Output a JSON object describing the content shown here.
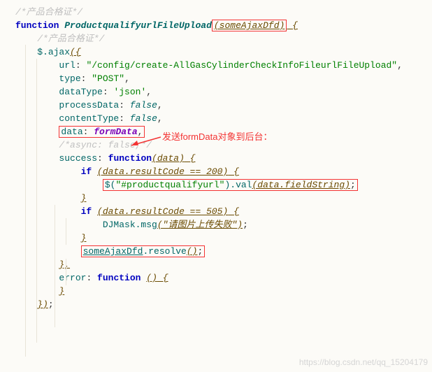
{
  "comments": {
    "top": "/*产品合格证*/",
    "inner": "/*产品合格证*/",
    "async": "/*async: false,*/"
  },
  "kw": {
    "function": "function",
    "false": "false",
    "if": "if"
  },
  "fn": {
    "main": "ProductqualifyurlFileUpload",
    "success_cb": "function",
    "error_cb": "function"
  },
  "param": {
    "main": "(someAjaxDfd)",
    "data": "(data)",
    "empty": "()"
  },
  "ajax": {
    "callee": "$.ajax",
    "open": "({",
    "url_k": "url",
    "url_v": "\"/config/create-AllGasCylinderCheckInfoFileurlFileUpload\"",
    "type_k": "type",
    "type_v": "\"POST\"",
    "dataType_k": "dataType",
    "dataType_v": "'json'",
    "processData_k": "processData",
    "contentType_k": "contentType",
    "data_k": "data",
    "data_v": "formData",
    "success_k": "success",
    "error_k": "error",
    "close": "})"
  },
  "success": {
    "cond1a": "(data",
    "cond1b": ".resultCode == 200)",
    "sel_open": "$(",
    "sel": "\"#productqualifyurl\"",
    "sel_close": ")",
    "val": ".val",
    "val_arg_a": "(data",
    "val_arg_b": ".fieldString)",
    "cond2a": "(data",
    "cond2b": ".resultCode == 505)",
    "djmask": "DJMask.msg",
    "djmask_arg": "(\"请图片上传失败\")",
    "resolve_obj": "someAjaxDfd",
    "resolve_call": ".resolve",
    "resolve_arg": "()"
  },
  "b": {
    "open": " {",
    "close": "}",
    "close_c": "},"
  },
  "p": {
    "semi": ";",
    "comma": ",",
    "colon": ": "
  },
  "annotation": {
    "send": "发送formData对象到后台："
  },
  "watermark": "https://blog.csdn.net/qq_15204179"
}
